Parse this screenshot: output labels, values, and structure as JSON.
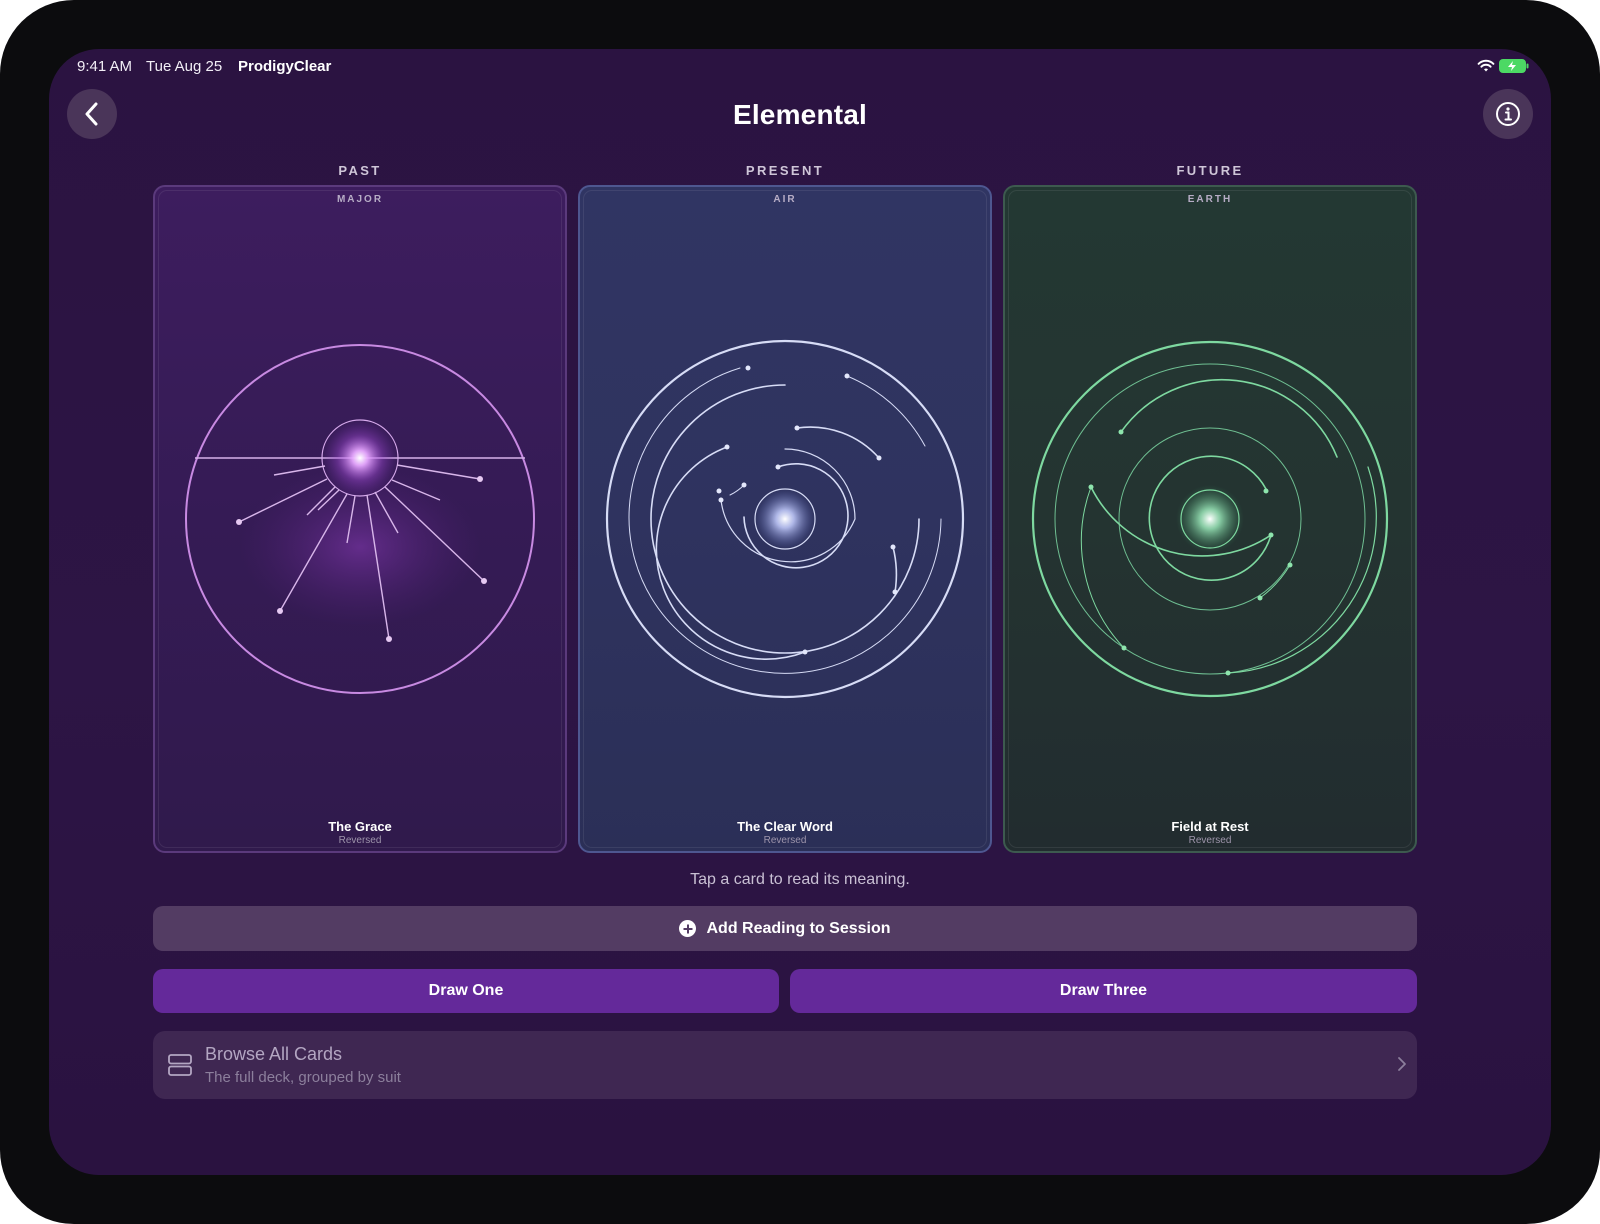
{
  "status_bar": {
    "time": "9:41 AM",
    "date": "Tue Aug 25",
    "app_name": "ProdigyClear",
    "battery_color": "#4cd964"
  },
  "nav": {
    "title": "Elemental",
    "back_icon": "chevron-left-icon",
    "info_icon": "info-circle-icon"
  },
  "spread": [
    {
      "position": "PAST",
      "suit": "MAJOR",
      "name": "The Grace",
      "orientation": "Reversed",
      "accent": "#d89cf0"
    },
    {
      "position": "PRESENT",
      "suit": "AIR",
      "name": "The Clear Word",
      "orientation": "Reversed",
      "accent": "#c9d2f5"
    },
    {
      "position": "FUTURE",
      "suit": "EARTH",
      "name": "Field at Rest",
      "orientation": "Reversed",
      "accent": "#7fe0a0"
    }
  ],
  "hint": "Tap a card to read its meaning.",
  "actions": {
    "add_reading": "Add Reading to Session",
    "draw_one": "Draw One",
    "draw_three": "Draw Three"
  },
  "browse": {
    "title": "Browse All Cards",
    "subtitle": "The full deck, grouped by suit"
  },
  "colors": {
    "background": "#2b1341",
    "primary_button": "#64299a",
    "secondary_button": "#533c63"
  }
}
